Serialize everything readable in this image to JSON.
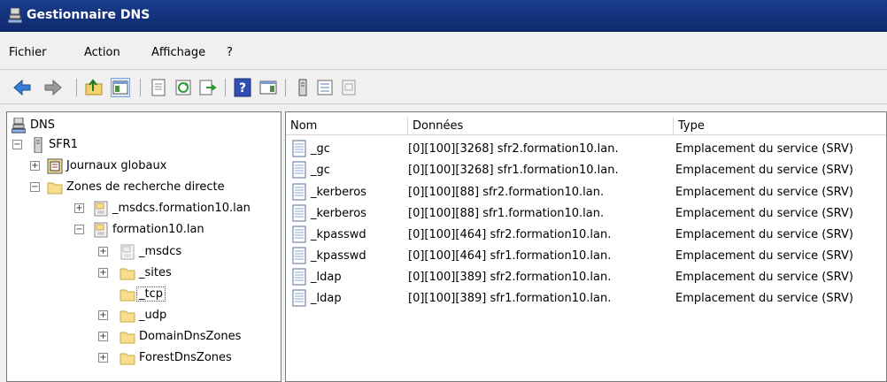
{
  "window": {
    "title": "Gestionnaire DNS"
  },
  "menu": [
    "Fichier",
    "Action",
    "Affichage",
    "?"
  ],
  "toolbar": {
    "icons": [
      "back-arrow-icon",
      "forward-arrow-icon",
      "up-folder-icon",
      "show-hide-tree-icon",
      "properties-icon",
      "refresh-icon",
      "export-list-icon",
      "help-icon",
      "show-action-pane-icon",
      "server-icon",
      "zone-icon",
      "record-icon"
    ]
  },
  "tree": [
    {
      "label": "DNS",
      "icon": "dns-root-icon"
    },
    {
      "label": "SFR1",
      "icon": "server-icon",
      "expander": "−"
    },
    {
      "label": "Journaux globaux",
      "icon": "event-log-icon",
      "expander": "+"
    },
    {
      "label": "Zones de recherche directe",
      "icon": "folder-icon",
      "expander": "−"
    },
    {
      "label": "_msdcs.formation10.lan",
      "icon": "zone-icon",
      "expander": "+"
    },
    {
      "label": "formation10.lan",
      "icon": "zone-icon",
      "expander": "−"
    },
    {
      "label": "_msdcs",
      "icon": "delegated-zone-icon",
      "expander": "+"
    },
    {
      "label": "_sites",
      "icon": "folder-icon",
      "expander": "+"
    },
    {
      "label": "_tcp",
      "icon": "folder-icon",
      "expander": "",
      "selected": true
    },
    {
      "label": "_udp",
      "icon": "folder-icon",
      "expander": "+"
    },
    {
      "label": "DomainDnsZones",
      "icon": "folder-icon",
      "expander": "+"
    },
    {
      "label": "ForestDnsZones",
      "icon": "folder-icon",
      "expander": "+"
    }
  ],
  "list": {
    "headers": [
      "Nom",
      "Données",
      "Type"
    ],
    "rows": [
      {
        "name": "_gc",
        "data": "[0][100][3268] sfr2.formation10.lan.",
        "type": "Emplacement du service (SRV)"
      },
      {
        "name": "_gc",
        "data": "[0][100][3268] sfr1.formation10.lan.",
        "type": "Emplacement du service (SRV)"
      },
      {
        "name": "_kerberos",
        "data": "[0][100][88] sfr2.formation10.lan.",
        "type": "Emplacement du service (SRV)"
      },
      {
        "name": "_kerberos",
        "data": "[0][100][88] sfr1.formation10.lan.",
        "type": "Emplacement du service (SRV)"
      },
      {
        "name": "_kpasswd",
        "data": "[0][100][464] sfr2.formation10.lan.",
        "type": "Emplacement du service (SRV)"
      },
      {
        "name": "_kpasswd",
        "data": "[0][100][464] sfr1.formation10.lan.",
        "type": "Emplacement du service (SRV)"
      },
      {
        "name": "_ldap",
        "data": "[0][100][389] sfr2.formation10.lan.",
        "type": "Emplacement du service (SRV)"
      },
      {
        "name": "_ldap",
        "data": "[0][100][389] sfr1.formation10.lan.",
        "type": "Emplacement du service (SRV)"
      }
    ]
  }
}
